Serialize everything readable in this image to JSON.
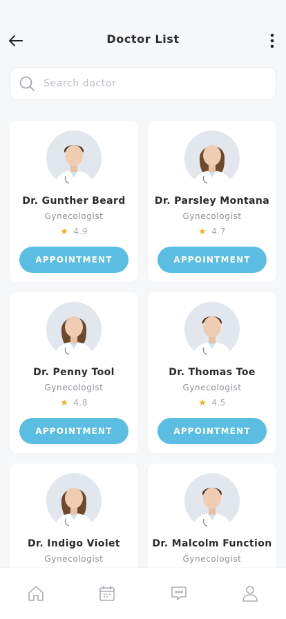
{
  "header": {
    "title": "Doctor List",
    "back_icon": "arrow-left-icon",
    "more_icon": "more-vertical-icon"
  },
  "search": {
    "placeholder": "Search doctor",
    "value": "",
    "icon": "search-icon"
  },
  "doctors": [
    {
      "name": "Dr. Gunther Beard",
      "specialty": "Gynecologist",
      "rating": "4.9",
      "button": "APPOINTMENT",
      "portrait": "male-doctor"
    },
    {
      "name": "Dr. Parsley Montana",
      "specialty": "Gynecologist",
      "rating": "4.7",
      "button": "APPOINTMENT",
      "portrait": "female-doctor"
    },
    {
      "name": "Dr. Penny Tool",
      "specialty": "Gynecologist",
      "rating": "4.8",
      "button": "APPOINTMENT",
      "portrait": "female-doctor"
    },
    {
      "name": "Dr. Thomas Toe",
      "specialty": "Gynecologist",
      "rating": "4.5",
      "button": "APPOINTMENT",
      "portrait": "male-doctor"
    },
    {
      "name": "Dr. Indigo Violet",
      "specialty": "Gynecologist",
      "rating": "",
      "button": "",
      "portrait": "female-doctor"
    },
    {
      "name": "Dr. Malcolm Function",
      "specialty": "Gynecologist",
      "rating": "",
      "button": "",
      "portrait": "male-doctor"
    }
  ],
  "bottom_nav": [
    {
      "icon": "home-icon"
    },
    {
      "icon": "calendar-icon"
    },
    {
      "icon": "chat-icon"
    },
    {
      "icon": "profile-icon"
    }
  ],
  "colors": {
    "accent": "#5bbde2",
    "star": "#f2b21b",
    "background": "#f6f7f9",
    "card": "#ffffff"
  }
}
